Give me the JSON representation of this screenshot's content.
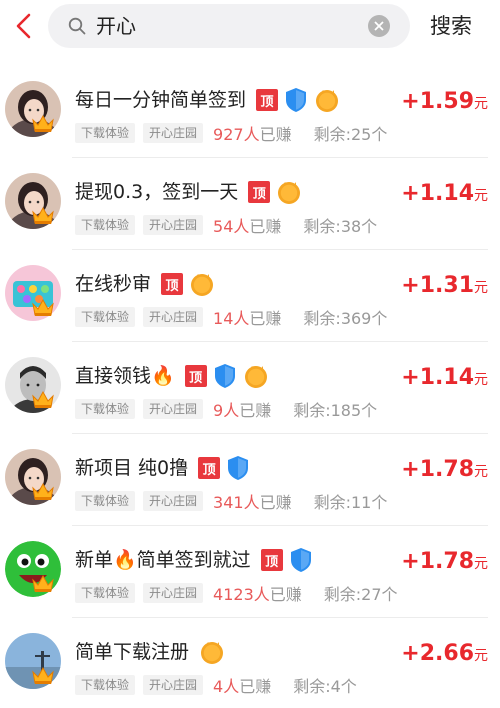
{
  "search": {
    "query": "开心",
    "button": "搜索"
  },
  "colors": {
    "accent": "#e8282d",
    "ding_badge": "#e8383d",
    "bao_badge": "#2b8ef0",
    "kuai_badge": "#f5a623"
  },
  "badge_labels": {
    "ding": "顶",
    "bao": "保",
    "kuai": "快审"
  },
  "items": [
    {
      "title": "每日一分钟简单签到",
      "badges": [
        "ding",
        "bao",
        "kuai"
      ],
      "tags": [
        "下载体验",
        "开心庄园"
      ],
      "earned_count": "927人",
      "earned_suffix": "已赚",
      "remaining": "剩余:25个",
      "price_prefix": "+",
      "price": "1.59",
      "price_unit": "元",
      "avatar_icon": "girl-photo-icon"
    },
    {
      "title": "提现0.3，签到一天",
      "badges": [
        "ding",
        "kuai"
      ],
      "tags": [
        "下载体验",
        "开心庄园"
      ],
      "earned_count": "54人",
      "earned_suffix": "已赚",
      "remaining": "剩余:38个",
      "price_prefix": "+",
      "price": "1.14",
      "price_unit": "元",
      "avatar_icon": "girl-photo-icon"
    },
    {
      "title": "在线秒审",
      "badges": [
        "ding",
        "kuai"
      ],
      "tags": [
        "下载体验",
        "开心庄园"
      ],
      "earned_count": "14人",
      "earned_suffix": "已赚",
      "remaining": "剩余:369个",
      "price_prefix": "+",
      "price": "1.31",
      "price_unit": "元",
      "avatar_icon": "toy-photo-icon"
    },
    {
      "title": "直接领钱🔥",
      "badges": [
        "ding",
        "bao",
        "kuai"
      ],
      "tags": [
        "下载体验",
        "开心庄园"
      ],
      "earned_count": "9人",
      "earned_suffix": "已赚",
      "remaining": "剩余:185个",
      "price_prefix": "+",
      "price": "1.14",
      "price_unit": "元",
      "avatar_icon": "man-portrait-icon"
    },
    {
      "title": "新项目  纯0撸",
      "badges": [
        "ding",
        "bao"
      ],
      "tags": [
        "下载体验",
        "开心庄园"
      ],
      "earned_count": "341人",
      "earned_suffix": "已赚",
      "remaining": "剩余:11个",
      "price_prefix": "+",
      "price": "1.78",
      "price_unit": "元",
      "avatar_icon": "girl-photo-icon"
    },
    {
      "title": "新单🔥简单签到就过",
      "badges": [
        "ding",
        "bao"
      ],
      "tags": [
        "下载体验",
        "开心庄园"
      ],
      "earned_count": "4123人",
      "earned_suffix": "已赚",
      "remaining": "剩余:27个",
      "price_prefix": "+",
      "price": "1.78",
      "price_unit": "元",
      "avatar_icon": "green-smiley-icon"
    },
    {
      "title": "简单下载注册",
      "badges": [
        "kuai"
      ],
      "tags": [
        "下载体验",
        "开心庄园"
      ],
      "earned_count": "4人",
      "earned_suffix": "已赚",
      "remaining": "剩余:4个",
      "price_prefix": "+",
      "price": "2.66",
      "price_unit": "元",
      "avatar_icon": "sky-photo-icon"
    }
  ]
}
